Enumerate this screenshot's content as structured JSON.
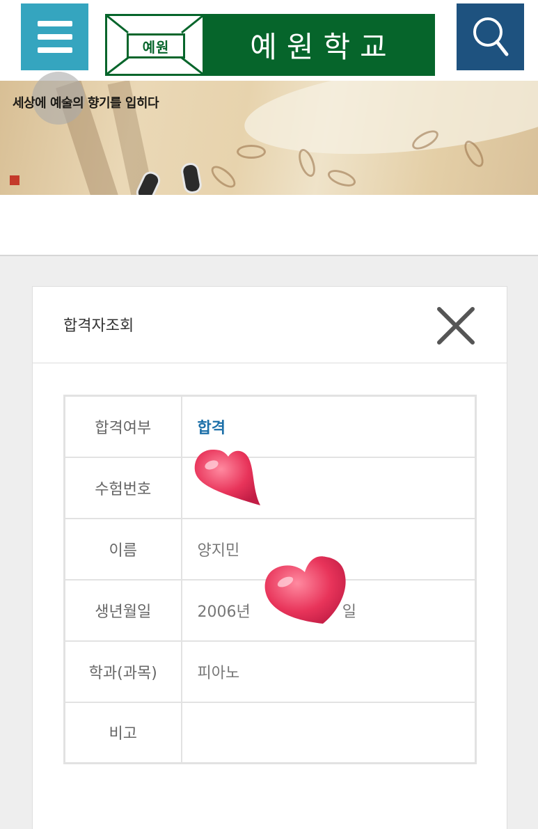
{
  "header": {
    "logo_mark": "예원",
    "school_name": "예원학교",
    "menu_icon": "hamburger-icon",
    "search_icon": "search-icon",
    "colors": {
      "menu_bg": "#35a5bf",
      "logo_bg": "#06652b",
      "search_bg": "#1e527f"
    }
  },
  "banner": {
    "slogan": "세상에 예술의 향기를 입히다"
  },
  "modal": {
    "title": "합격자조회",
    "close_icon": "close-icon",
    "rows": [
      {
        "label": "합격여부",
        "value": "합격"
      },
      {
        "label": "수험번호",
        "value": ""
      },
      {
        "label": "이름",
        "value": "양지민"
      },
      {
        "label": "생년월일",
        "value_start": "2006년",
        "value_end": "일"
      },
      {
        "label": "학과(과목)",
        "value": "피아노"
      },
      {
        "label": "비고",
        "value": ""
      }
    ],
    "colors": {
      "pass": "#1c6fa8",
      "heart": "#e63a5c"
    }
  }
}
